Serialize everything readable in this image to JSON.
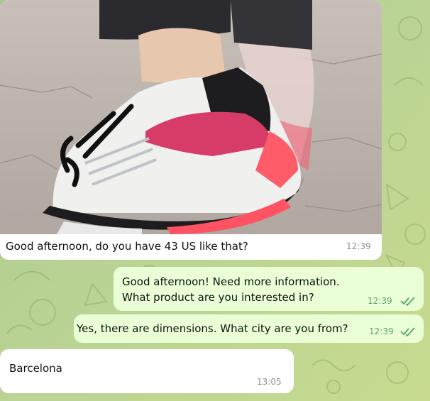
{
  "messages": [
    {
      "id": "m1",
      "direction": "incoming",
      "type": "photo",
      "caption": "Good afternoon, do you have 43 US like that?",
      "time": "12:39"
    },
    {
      "id": "m2",
      "direction": "outgoing",
      "lines": [
        "Good afternoon! Need more information.",
        "What product are you interested in?"
      ],
      "time": "12:39",
      "status": "read"
    },
    {
      "id": "m3",
      "direction": "outgoing",
      "text": "Yes, there are dimensions. What city are you from?",
      "time": "12:39",
      "status": "read"
    },
    {
      "id": "m4",
      "direction": "incoming",
      "text": "Barcelona",
      "time": "13:05"
    }
  ],
  "colors": {
    "wallpaper": "#b9d394",
    "incoming_bubble": "#ffffff",
    "outgoing_bubble": "#eaffd6",
    "read_ticks": "#5ba465"
  },
  "icons": {
    "read_receipt": "double-check-icon"
  }
}
